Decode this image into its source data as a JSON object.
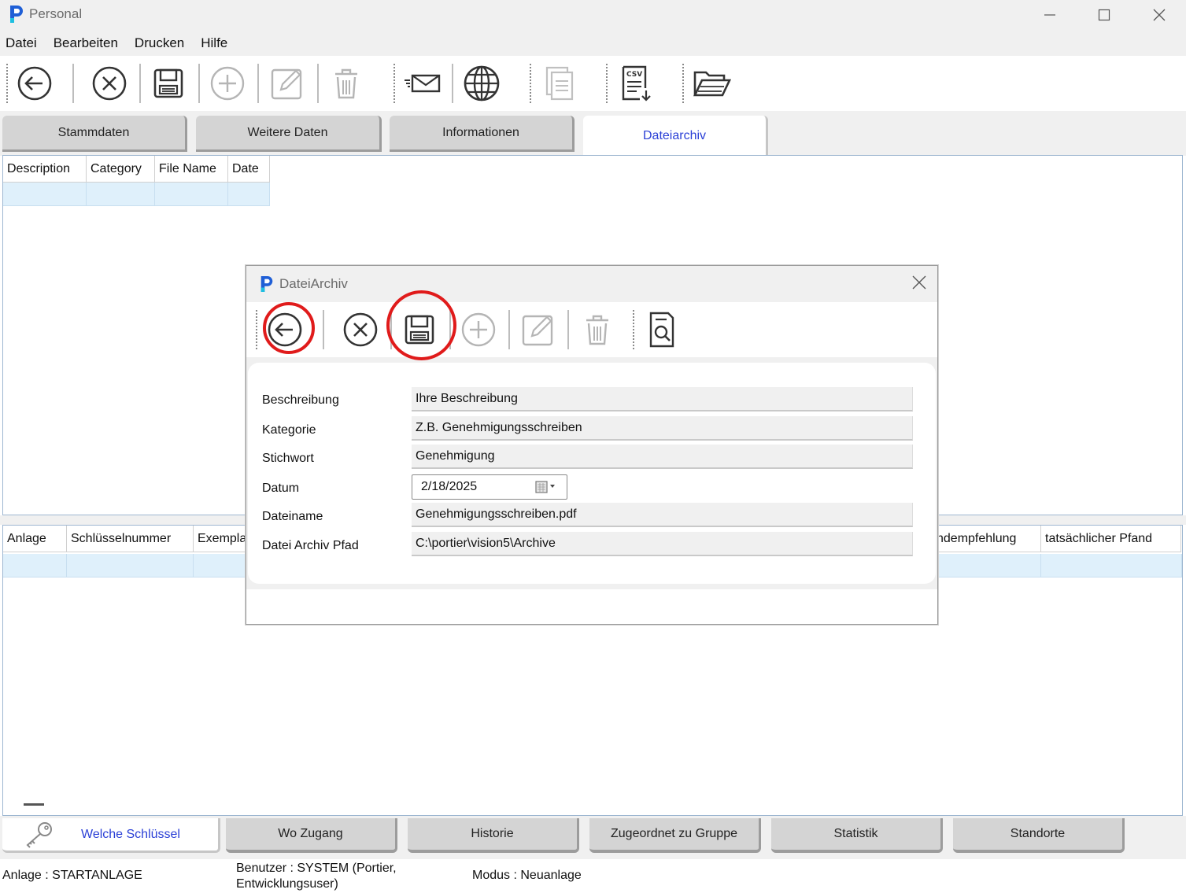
{
  "window": {
    "title": "Personal",
    "minimize_icon": "minimize-icon",
    "maximize_icon": "maximize-icon",
    "close_icon": "close-icon"
  },
  "menu": {
    "items": [
      "Datei",
      "Bearbeiten",
      "Drucken",
      "Hilfe"
    ]
  },
  "toolbar": {
    "icons": [
      "back-arrow-icon",
      "cancel-icon",
      "save-icon",
      "add-icon",
      "edit-icon",
      "delete-icon",
      "email-icon",
      "globe-icon",
      "copy-icon",
      "csv-export-icon",
      "open-folder-icon"
    ]
  },
  "tabs": {
    "items": [
      {
        "label": "Stammdaten",
        "active": false
      },
      {
        "label": "Weitere Daten",
        "active": false
      },
      {
        "label": "Informationen",
        "active": false
      },
      {
        "label": "Dateiarchiv",
        "active": true
      }
    ]
  },
  "upper_grid": {
    "columns": [
      "Description",
      "Category",
      "File Name",
      "Date"
    ],
    "rows": [
      [
        "",
        "",
        "",
        ""
      ]
    ]
  },
  "lower_grid": {
    "columns": [
      "Anlage",
      "Schlüsselnummer",
      "Exempla",
      "ndempfehlung",
      "tatsächlicher Pfand"
    ],
    "rows": [
      [
        "",
        "",
        "",
        "",
        ""
      ]
    ]
  },
  "dialog": {
    "title": "DateiArchiv",
    "toolbar_icons": [
      "back-arrow-icon",
      "cancel-icon",
      "save-icon",
      "add-icon",
      "edit-icon",
      "delete-icon",
      "document-search-icon"
    ],
    "fields": {
      "beschreibung": {
        "label": "Beschreibung",
        "value": "Ihre Beschreibung"
      },
      "kategorie": {
        "label": "Kategorie",
        "value": "Z.B. Genehmigungsschreiben"
      },
      "stichwort": {
        "label": "Stichwort",
        "value": "Genehmigung"
      },
      "datum": {
        "label": "Datum",
        "value": "2/18/2025"
      },
      "dateiname": {
        "label": "Dateiname",
        "value": "Genehmigungsschreiben.pdf"
      },
      "pfad": {
        "label": "Datei Archiv Pfad",
        "value": "C:\\portier\\vision5\\Archive"
      }
    },
    "highlight_color": "#e01b1b"
  },
  "bottom_tabs": {
    "items": [
      {
        "label": "Welche Schlüssel",
        "active": true
      },
      {
        "label": "Wo Zugang",
        "active": false
      },
      {
        "label": "Historie",
        "active": false
      },
      {
        "label": "Zugeordnet zu Gruppe",
        "active": false
      },
      {
        "label": "Statistik",
        "active": false
      },
      {
        "label": "Standorte",
        "active": false
      }
    ]
  },
  "status": {
    "anlage": "Anlage  : STARTANLAGE",
    "benutzer_line1": "Benutzer : SYSTEM  (Portier,",
    "benutzer_line2": "Entwicklungsuser)",
    "modus": "Modus : Neuanlage"
  },
  "colors": {
    "accent_blue": "#2a3fd6",
    "selected_row": "#dff0fb",
    "window_bg": "#f0f0f0"
  }
}
